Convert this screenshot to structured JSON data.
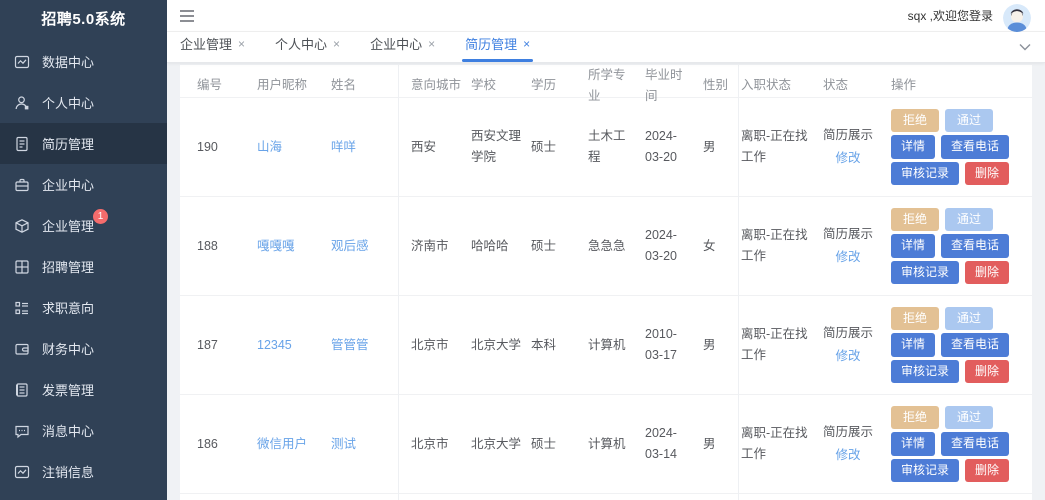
{
  "app": {
    "title": "招聘5.0系统"
  },
  "sidebar": {
    "items": [
      {
        "key": "data-center",
        "icon": "chart-icon",
        "label": "数据中心",
        "selected": false
      },
      {
        "key": "personal-center",
        "icon": "user-icon",
        "label": "个人中心",
        "selected": false
      },
      {
        "key": "resume-management",
        "icon": "document-icon",
        "label": "简历管理",
        "selected": true
      },
      {
        "key": "enterprise-center",
        "icon": "briefcase-icon",
        "label": "企业中心",
        "selected": false
      },
      {
        "key": "enterprise-management",
        "icon": "cube-icon",
        "label": "企业管理",
        "selected": false,
        "badge": "1"
      },
      {
        "key": "recruitment-management",
        "icon": "grid-icon",
        "label": "招聘管理",
        "selected": false
      },
      {
        "key": "job-intention",
        "icon": "list-icon",
        "label": "求职意向",
        "selected": false
      },
      {
        "key": "finance-center",
        "icon": "wallet-icon",
        "label": "财务中心",
        "selected": false
      },
      {
        "key": "invoice-management",
        "icon": "invoice-icon",
        "label": "发票管理",
        "selected": false
      },
      {
        "key": "message-center",
        "icon": "message-icon",
        "label": "消息中心",
        "selected": false
      },
      {
        "key": "logout-info",
        "icon": "logout-icon",
        "label": "注销信息",
        "selected": false
      }
    ]
  },
  "header": {
    "welcome": "sqx ,欢迎您登录"
  },
  "tabs": [
    {
      "label": "企业管理",
      "close": "×",
      "active": false
    },
    {
      "label": "个人中心",
      "close": "×",
      "active": false
    },
    {
      "label": "企业中心",
      "close": "×",
      "active": false
    },
    {
      "label": "简历管理",
      "close": "×",
      "active": true
    }
  ],
  "table": {
    "columns": [
      "编号",
      "用户昵称",
      "姓名",
      "意向城市",
      "学校",
      "学历",
      "所学专业",
      "毕业时间",
      "性别",
      "入职状态",
      "状态",
      "操作"
    ],
    "actions": {
      "reject": "拒绝",
      "pass": "通过",
      "detail": "详情",
      "view_phone": "查看电话",
      "audit_record": "审核记录",
      "delete": "删除"
    },
    "rows": [
      {
        "id": "190",
        "nickname": "山海",
        "name": "咩咩",
        "city": "西安",
        "school": "西安文理学院",
        "degree": "硕士",
        "major": "土木工程",
        "grad_date": "2024-03-20",
        "gender": "男",
        "job_status": "离职-正在找工作",
        "status": "简历展示",
        "status_link": "修改"
      },
      {
        "id": "188",
        "nickname": "嘎嘎嘎",
        "name": "观后感",
        "city": "济南市",
        "school": "哈哈哈",
        "degree": "硕士",
        "major": "急急急",
        "grad_date": "2024-03-20",
        "gender": "女",
        "job_status": "离职-正在找工作",
        "status": "简历展示",
        "status_link": "修改"
      },
      {
        "id": "187",
        "nickname": "12345",
        "name": "管管管",
        "city": "北京市",
        "school": "北京大学",
        "degree": "本科",
        "major": "计算机",
        "grad_date": "2010-03-17",
        "gender": "男",
        "job_status": "离职-正在找工作",
        "status": "简历展示",
        "status_link": "修改"
      },
      {
        "id": "186",
        "nickname": "微信用户",
        "name": "测试",
        "city": "北京市",
        "school": "北京大学",
        "degree": "硕士",
        "major": "计算机",
        "grad_date": "2024-03-14",
        "gender": "男",
        "job_status": "离职-正在找工作",
        "status": "简历展示",
        "status_link": "修改"
      }
    ]
  },
  "colors": {
    "sidebar_bg": "#304156",
    "sidebar_selected_bg": "#263445",
    "badge_red": "#f56c6c",
    "accent_blue": "#3e7fe0",
    "link_blue": "#68a3e8",
    "button_primary_blue": "#4d7cd6",
    "button_danger_red": "#e25d5d",
    "button_reject_tan": "#e3c194",
    "button_pass_lightblue": "#abc8f0",
    "page_bg": "#f0f2f5"
  }
}
